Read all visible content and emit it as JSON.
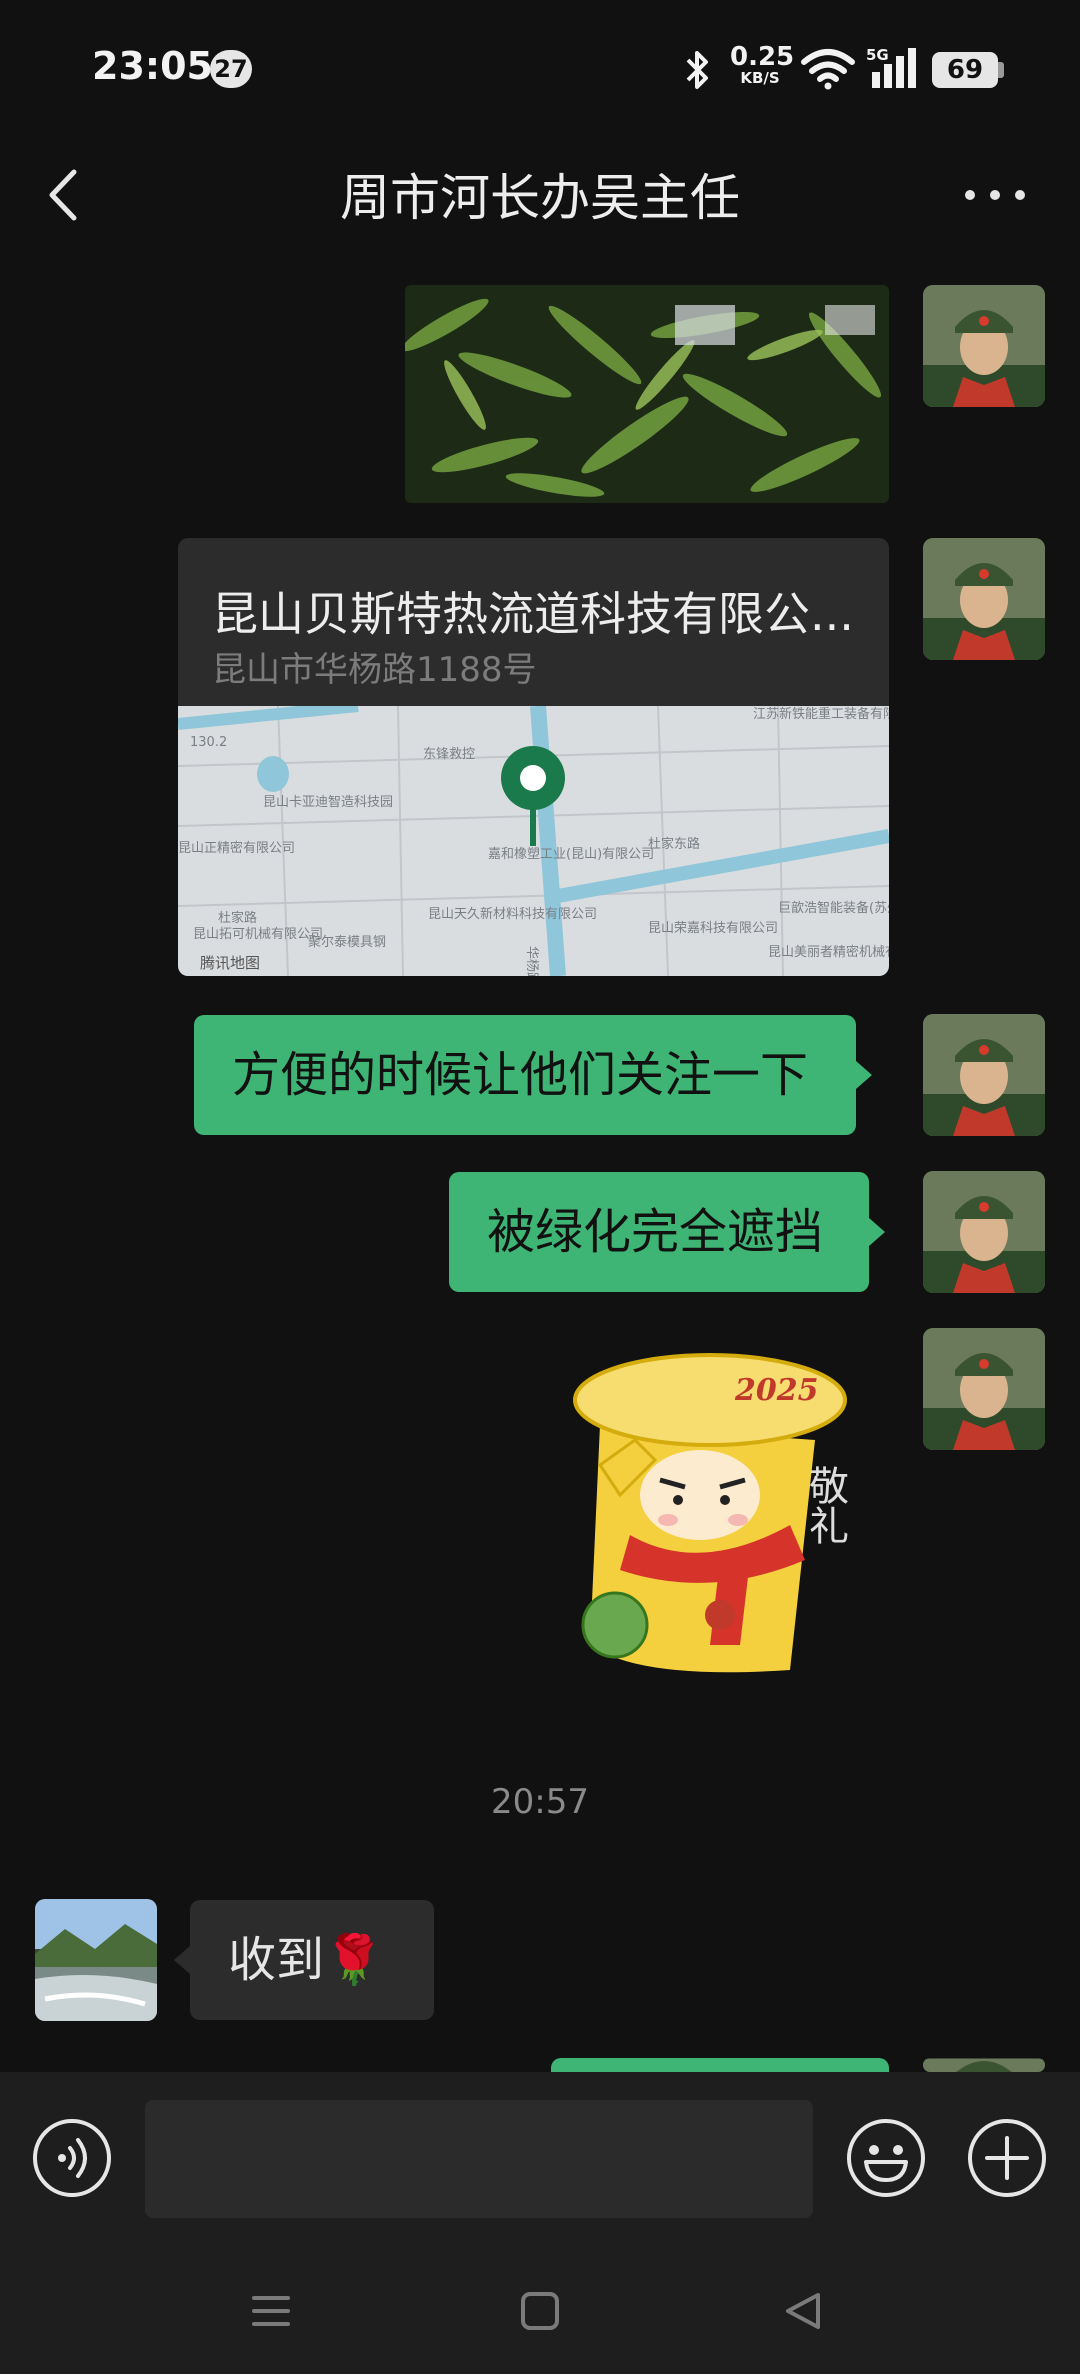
{
  "status_bar": {
    "time": "23:05",
    "notification_count": "27",
    "net_speed_value": "0.25",
    "net_speed_unit": "KB/S",
    "signal_label": "5G",
    "battery": "69"
  },
  "header": {
    "title": "周市河长办吴主任"
  },
  "messages": {
    "location": {
      "name": "昆山贝斯特热流道科技有限公...",
      "address": "昆山市华杨路1188号",
      "map_attribution": "腾讯地图",
      "map_labels": [
        "东锋救控",
        "昆山卡亚迪智造科技园",
        "嘉和橡塑工业(昆山)有限公司",
        "江苏新铁能重工装备有限公司",
        "杜家东路",
        "杜家路",
        "昆山天久新材料科技有限公司",
        "昆山荣嘉科技有限公司",
        "巨歆浩智能装备(苏州)有限公司",
        "昆山拓可机械有限公司",
        "昆山美丽者精密机械有限公司",
        "聚尔泰模具钢",
        "130.2",
        "华杨路",
        "昆山正精密有限公司"
      ]
    },
    "text_1": "方便的时候让他们关注一下",
    "text_2": "被绿化完全遮挡",
    "sticker_text": "敬礼",
    "sticker_year": "2025",
    "time_separator": "20:57",
    "received_text": "收到🌹"
  },
  "colors": {
    "background": "#111111",
    "sent_bubble": "#3eb575",
    "received_bubble": "#2c2c2c",
    "input_bar": "#1e1e1e"
  },
  "icons": {
    "back": "chevron-left-icon",
    "more": "ellipsis-icon",
    "voice": "voice-icon",
    "emoji": "emoji-icon",
    "plus": "plus-icon"
  }
}
